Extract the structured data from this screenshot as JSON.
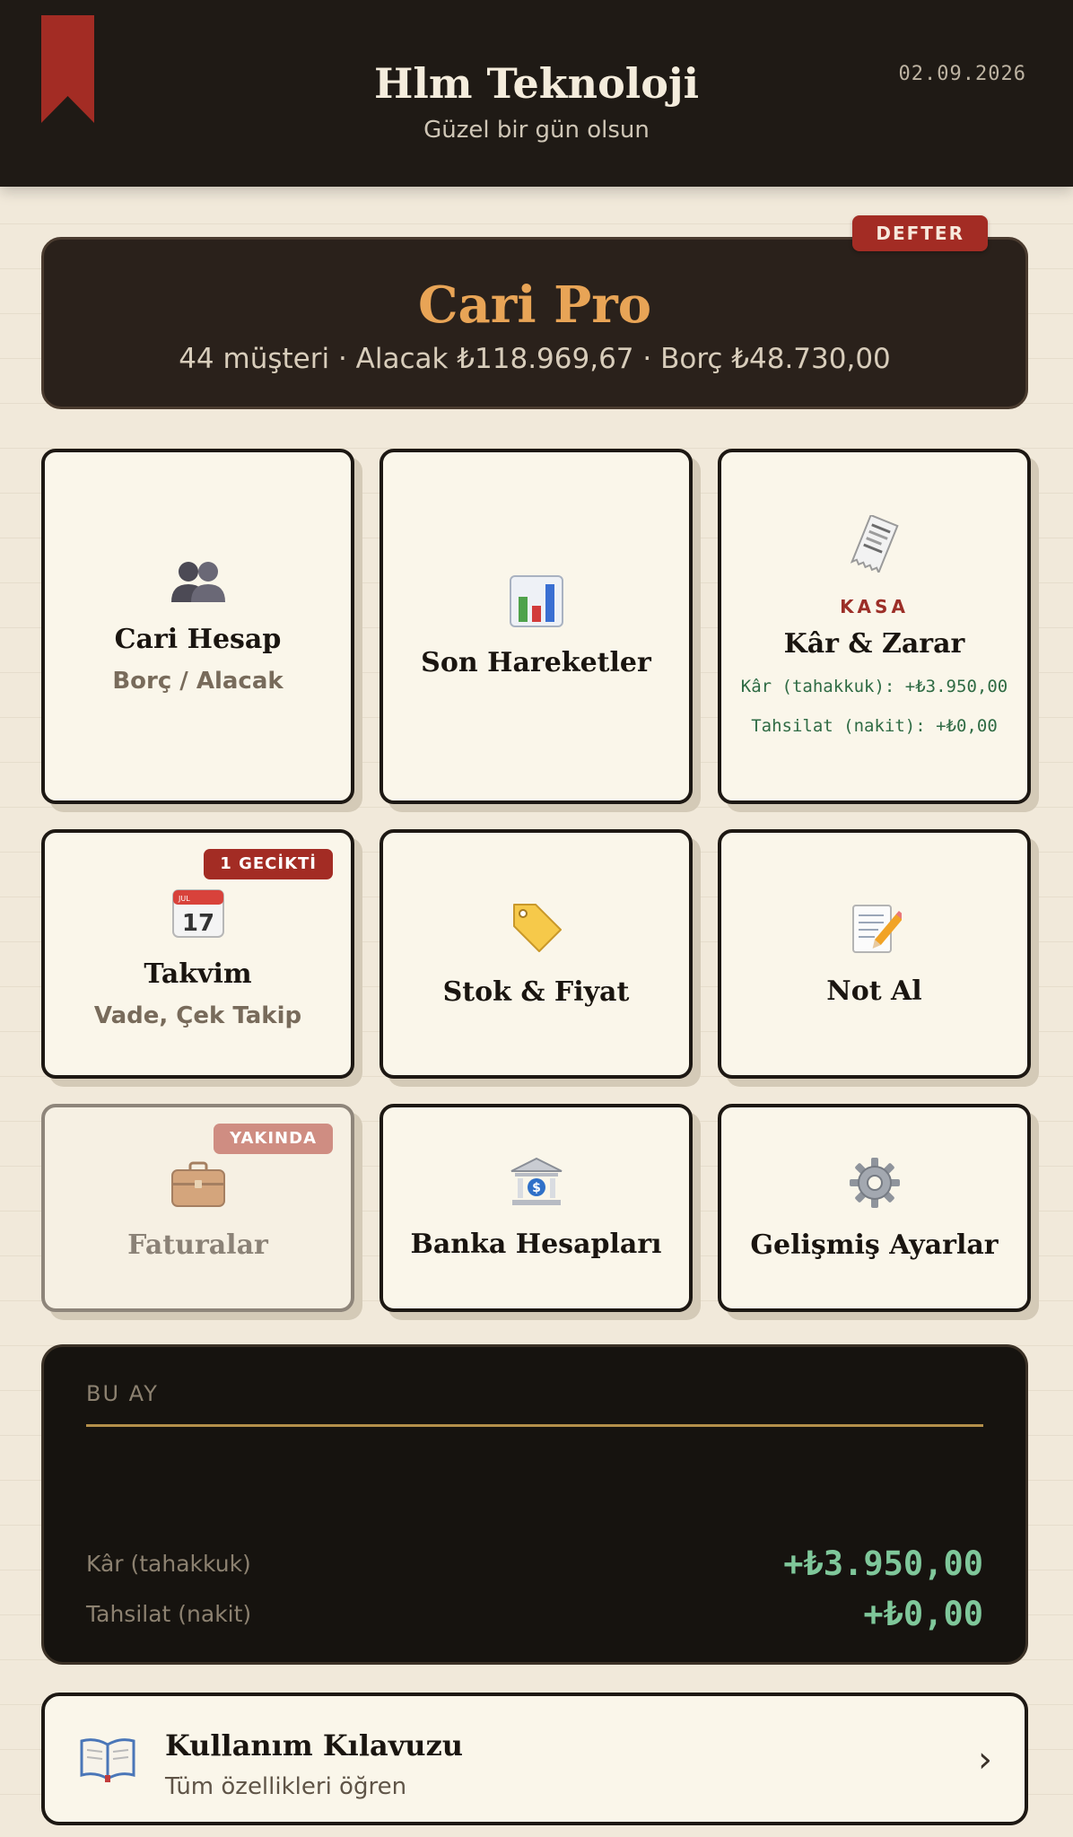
{
  "header": {
    "company": "Hlm Teknoloji",
    "greeting": "Güzel bir gün olsun",
    "date": "02.09.2026",
    "bookmark_icon": "bookmark-icon"
  },
  "hero": {
    "badge": "DEFTER",
    "title": "Cari Pro",
    "stats": "44 müşteri · Alacak ₺118.969,67 · Borç ₺48.730,00"
  },
  "cards": {
    "cari": {
      "icon": "people-icon",
      "title": "Cari Hesap",
      "subtitle": "Borç / Alacak"
    },
    "hareket": {
      "icon": "bar-chart-icon",
      "title": "Son Hareketler"
    },
    "kasa": {
      "icon": "receipt-icon",
      "kicker": "KASA",
      "title": "Kâr & Zarar",
      "line1": "Kâr (tahakkuk): +₺3.950,00",
      "line2": "Tahsilat (nakit): +₺0,00"
    },
    "takvim": {
      "icon": "calendar-icon",
      "badge": "1 GECİKTİ",
      "title": "Takvim",
      "subtitle": "Vade, Çek Takip",
      "cal_month": "JUL",
      "cal_day": "17"
    },
    "stok": {
      "icon": "price-tag-icon",
      "title": "Stok & Fiyat"
    },
    "not": {
      "icon": "memo-icon",
      "title": "Not Al"
    },
    "fatura": {
      "icon": "briefcase-icon",
      "badge": "YAKINDA",
      "title": "Faturalar"
    },
    "banka": {
      "icon": "bank-icon",
      "title": "Banka Hesapları",
      "bank_sign": "$"
    },
    "ayar": {
      "icon": "gear-icon",
      "title": "Gelişmiş Ayarlar"
    }
  },
  "month": {
    "label": "BU AY",
    "rows": [
      {
        "label": "Kâr (tahakkuk)",
        "value": "+₺3.950,00"
      },
      {
        "label": "Tahsilat (nakit)",
        "value": "+₺0,00"
      }
    ]
  },
  "guide": {
    "icon": "open-book-icon",
    "title": "Kullanım Kılavuzu",
    "subtitle": "Tüm özellikleri öğren",
    "chevron": "›"
  },
  "colors": {
    "header_bg": "#1f1a15",
    "accent_orange": "#e8a456",
    "badge_red": "#a32c24",
    "positive_green": "#7fc79a",
    "card_bg": "#faf6ea"
  }
}
